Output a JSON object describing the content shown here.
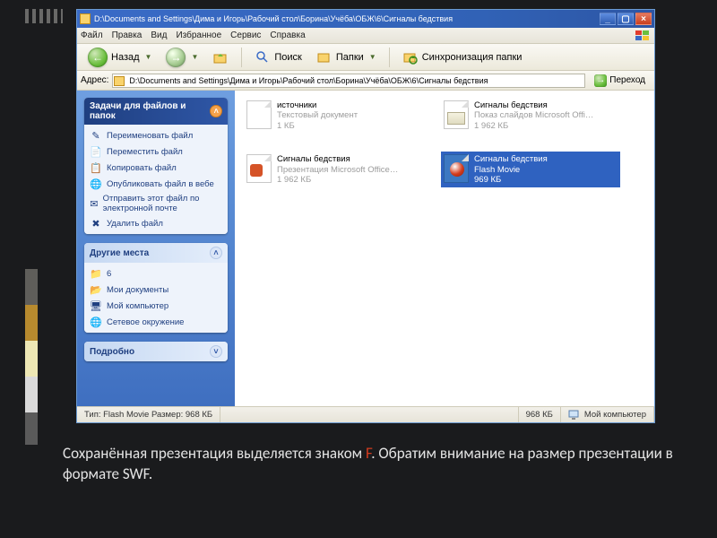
{
  "titlebar": {
    "path": "D:\\Documents and Settings\\Дима и Игорь\\Рабочий стол\\Борина\\Учёба\\ОБЖ\\6\\Сигналы бедствия"
  },
  "menu": {
    "file": "Файл",
    "edit": "Правка",
    "view": "Вид",
    "favorites": "Избранное",
    "tools": "Сервис",
    "help": "Справка"
  },
  "toolbar": {
    "back": "Назад",
    "search": "Поиск",
    "folders": "Папки",
    "sync": "Синхронизация папки"
  },
  "address": {
    "label": "Адрес:",
    "value": "D:\\Documents and Settings\\Дима и Игорь\\Рабочий стол\\Борина\\Учёба\\ОБЖ\\6\\Сигналы бедствия",
    "go": "Переход"
  },
  "side": {
    "tasks": {
      "title": "Задачи для файлов и папок",
      "items": [
        "Переименовать файл",
        "Переместить файл",
        "Копировать файл",
        "Опубликовать файл в вебе",
        "Отправить этот файл по электронной почте",
        "Удалить файл"
      ]
    },
    "places": {
      "title": "Другие места",
      "items": [
        "6",
        "Мои документы",
        "Мой компьютер",
        "Сетевое окружение"
      ]
    },
    "details": {
      "title": "Подробно"
    }
  },
  "files": [
    {
      "name": "источники",
      "type": "Текстовый документ",
      "size": "1 КБ",
      "icon": "txt",
      "selected": false
    },
    {
      "name": "Сигналы бедствия",
      "type": "Показ слайдов Microsoft Offi…",
      "size": "1 962 КБ",
      "icon": "pptshow",
      "selected": false
    },
    {
      "name": "Сигналы бедствия",
      "type": "Презентация Microsoft Office…",
      "size": "1 962 КБ",
      "icon": "ppt",
      "selected": false
    },
    {
      "name": "Сигналы бедствия",
      "type": "Flash Movie",
      "size": "969 КБ",
      "icon": "flash",
      "selected": true
    }
  ],
  "status": {
    "type_label": "Тип: Flash Movie Размер: 968 КБ",
    "size": "968 КБ",
    "location": "Мой компьютер"
  },
  "caption": {
    "pre": "Сохранённая презентация выделяется знаком  ",
    "f": "F",
    "post1": ".  Обратим внимание на размер презентации в формате  ",
    "swf": "SWF",
    "post2": "."
  },
  "colors": {
    "accent": "#3a6bc7",
    "green": "#6bbf3d",
    "red": "#d43c1e"
  }
}
